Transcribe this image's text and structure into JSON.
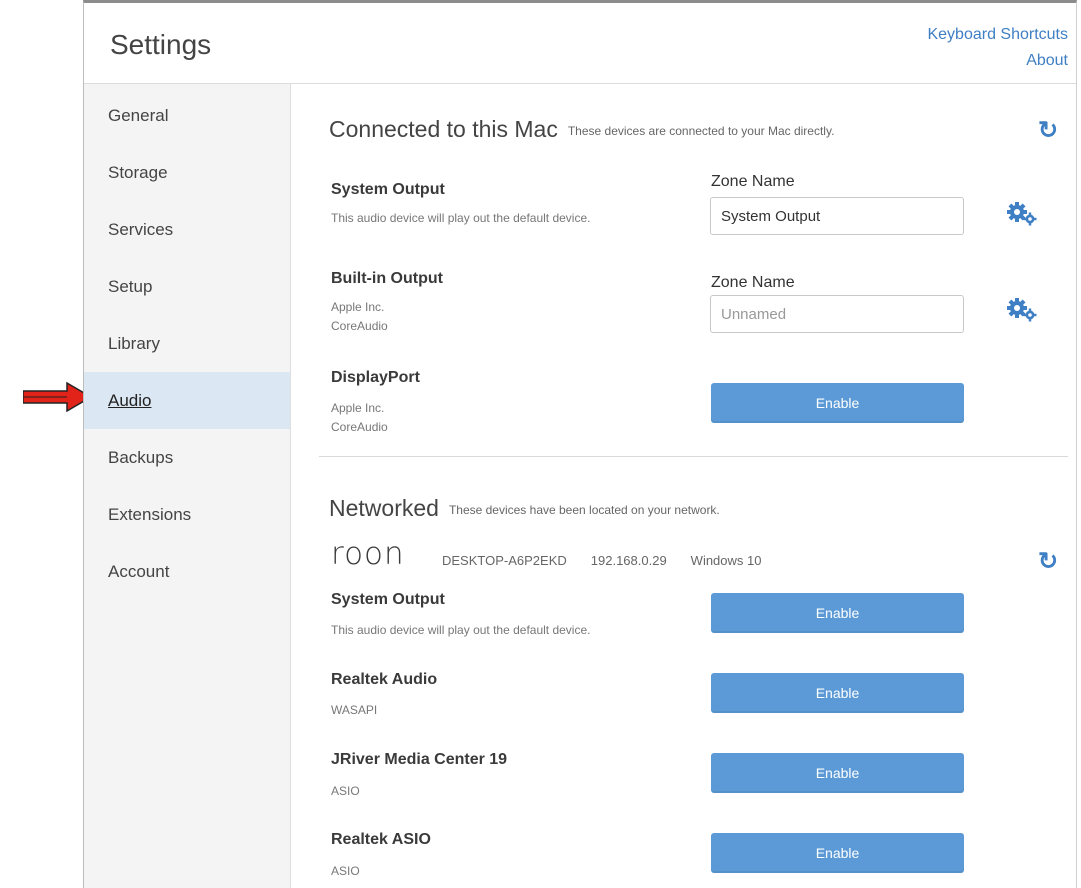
{
  "header": {
    "title": "Settings",
    "keyboard_shortcuts": "Keyboard Shortcuts",
    "about": "About"
  },
  "sidebar": {
    "items": [
      {
        "label": "General"
      },
      {
        "label": "Storage"
      },
      {
        "label": "Services"
      },
      {
        "label": "Setup"
      },
      {
        "label": "Library"
      },
      {
        "label": "Audio",
        "active": true
      },
      {
        "label": "Backups"
      },
      {
        "label": "Extensions"
      },
      {
        "label": "Account"
      }
    ]
  },
  "connected": {
    "title": "Connected to this Mac",
    "description": "These devices are connected to your Mac directly.",
    "zone_label": "Zone Name",
    "devices": [
      {
        "name": "System Output",
        "sub": "This audio device will play out the default device.",
        "zone_value": "System Output"
      },
      {
        "name": "Built-in Output",
        "sub1": "Apple Inc.",
        "sub2": "CoreAudio",
        "zone_placeholder": "Unnamed"
      },
      {
        "name": "DisplayPort",
        "sub1": "Apple Inc.",
        "sub2": "CoreAudio",
        "button": "Enable"
      }
    ]
  },
  "networked": {
    "title": "Networked",
    "description": "These devices have been located on your network.",
    "logo": "roon",
    "host": {
      "name": "DESKTOP-A6P2EKD",
      "ip": "192.168.0.29",
      "os": "Windows 10"
    },
    "devices": [
      {
        "name": "System Output",
        "sub": "This audio device will play out the default device.",
        "button": "Enable"
      },
      {
        "name": "Realtek Audio",
        "sub": "WASAPI",
        "button": "Enable"
      },
      {
        "name": "JRiver Media Center 19",
        "sub": "ASIO",
        "button": "Enable"
      },
      {
        "name": "Realtek ASIO",
        "sub": "ASIO",
        "button": "Enable"
      }
    ]
  },
  "colors": {
    "accent": "#3f7fc4",
    "button": "#5b9ad6",
    "active_nav": "#dbe7f2",
    "arrow": "#e2231a"
  },
  "icons": {
    "refresh": "refresh-icon",
    "gear": "gears-icon",
    "arrow": "red-arrow-icon"
  }
}
